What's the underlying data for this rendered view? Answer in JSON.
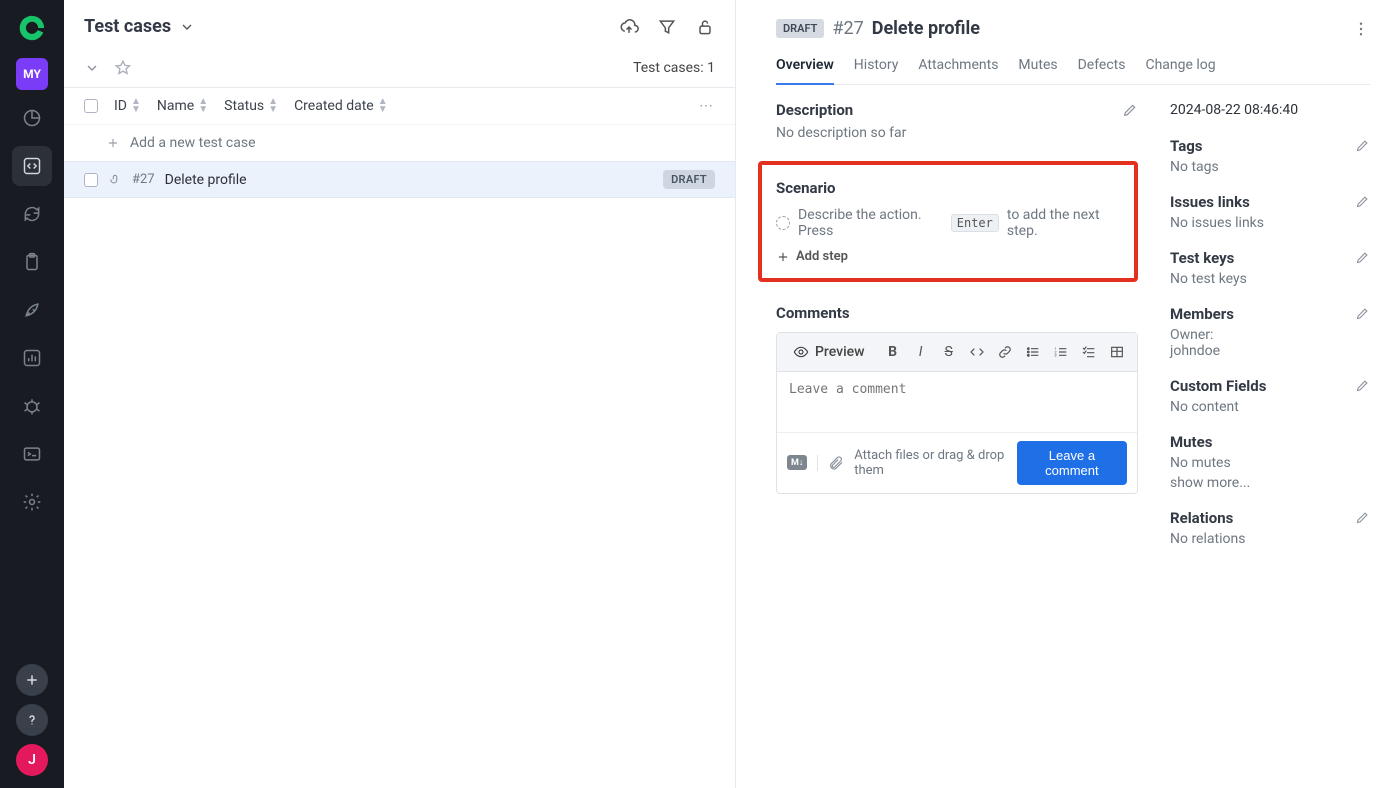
{
  "sidebar": {
    "project_badge": "MY",
    "avatar_letter": "J"
  },
  "header": {
    "title": "Test cases"
  },
  "subbar": {
    "count_label": "Test cases: 1"
  },
  "columns": {
    "id": "ID",
    "name": "Name",
    "status": "Status",
    "created": "Created date"
  },
  "add_row_label": "Add a new test case",
  "rows": [
    {
      "id": "#27",
      "title": "Delete profile",
      "chip": "DRAFT"
    }
  ],
  "detail": {
    "draft_label": "DRAFT",
    "hash": "#27",
    "title": "Delete profile",
    "tabs": [
      "Overview",
      "History",
      "Attachments",
      "Mutes",
      "Defects",
      "Change log"
    ],
    "description": {
      "label": "Description",
      "value": "No description so far"
    },
    "scenario": {
      "label": "Scenario",
      "hint_pre": "Describe the action. Press",
      "hint_key": "Enter",
      "hint_post": "to add the next step.",
      "add_step": "Add step"
    },
    "comments": {
      "label": "Comments",
      "preview": "Preview",
      "placeholder": "Leave a comment",
      "attach_hint": "Attach files or drag & drop them",
      "submit": "Leave a comment",
      "md_badge": "M↓"
    },
    "timestamp": "2024-08-22 08:46:40",
    "meta": {
      "tags": {
        "label": "Tags",
        "value": "No tags"
      },
      "issues": {
        "label": "Issues links",
        "value": "No issues links"
      },
      "testkeys": {
        "label": "Test keys",
        "value": "No test keys"
      },
      "members": {
        "label": "Members",
        "owner_label": "Owner:",
        "owner": "johndoe"
      },
      "custom": {
        "label": "Custom Fields",
        "value": "No content"
      },
      "mutes": {
        "label": "Mutes",
        "value": "No mutes",
        "more": "show more..."
      },
      "relations": {
        "label": "Relations",
        "value": "No relations"
      }
    }
  }
}
